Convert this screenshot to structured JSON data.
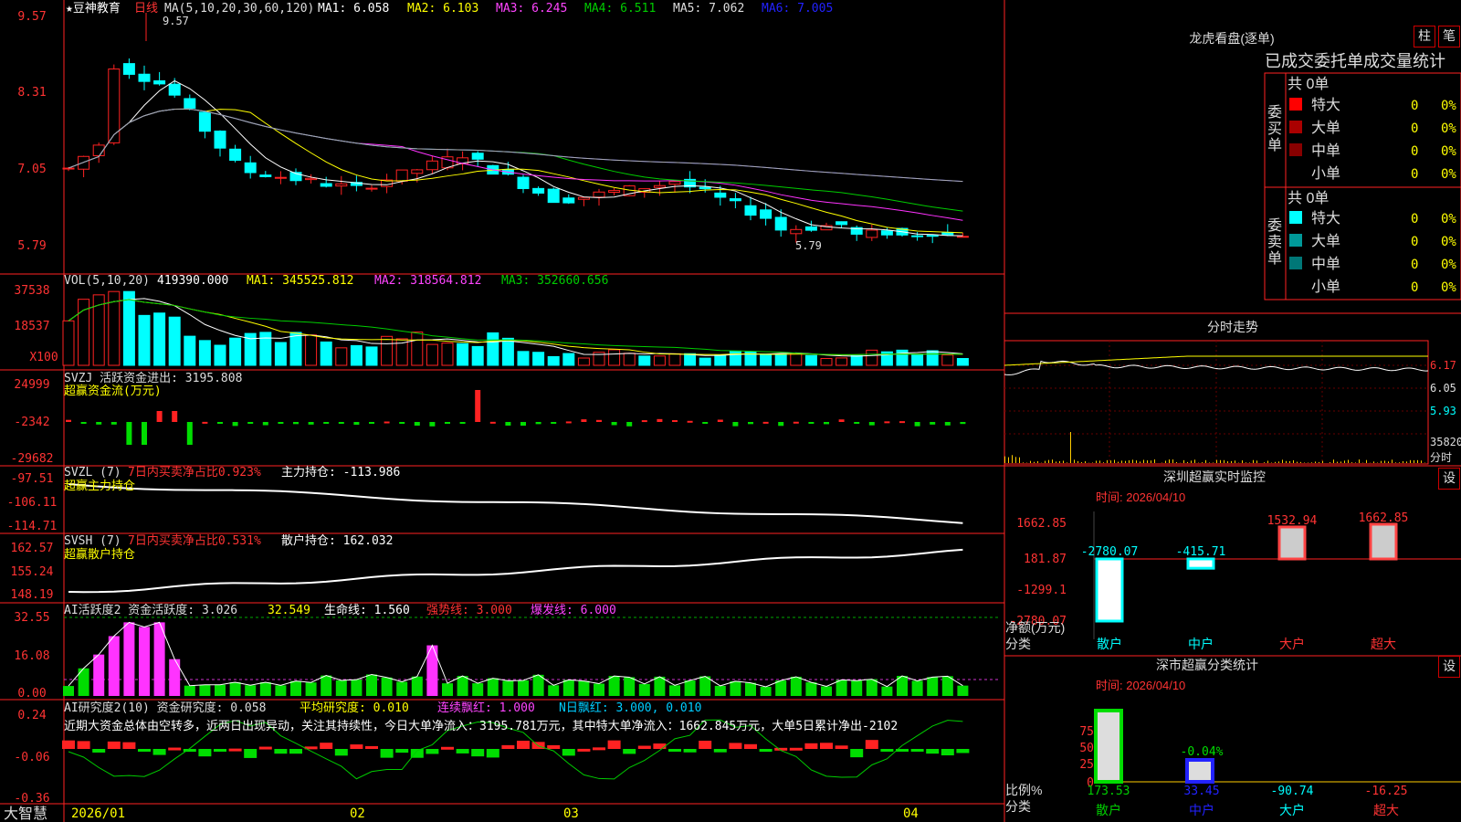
{
  "stock": {
    "name": "★豆神教育",
    "period": "日线"
  },
  "ma": {
    "label": "MA(5,10,20,30,60,120)",
    "ma1": "MA1: 6.058",
    "ma2": "MA2: 6.103",
    "ma3": "MA3: 6.245",
    "ma4": "MA4: 6.511",
    "ma5": "MA5: 7.062",
    "ma6": "MA6: 7.005",
    "high": "9.57",
    "low": "5.79"
  },
  "price_axis": [
    "9.57",
    "8.31",
    "7.05",
    "5.79"
  ],
  "vol": {
    "label": "VOL(5,10,20)",
    "value": "419390.000",
    "ma1": "MA1: 345525.812",
    "ma2": "MA2: 318564.812",
    "ma3": "MA3: 352660.656",
    "axis": [
      "37538",
      "18537"
    ],
    "unit": "X100"
  },
  "svzj": {
    "label": "SVZJ  活跃资金进出: 3195.808",
    "sub": "超赢资金流(万元)",
    "axis": [
      "24999",
      "-2342",
      "-29682"
    ]
  },
  "svzl": {
    "label": "SVZL (7)",
    "pct": "7日内买卖净占比0.923%",
    "main": "主力持仓: -113.986",
    "sub": "超赢主力持仓",
    "axis": [
      "-97.51",
      "-106.11",
      "-114.71"
    ]
  },
  "svsh": {
    "label": "SVSH (7)",
    "pct": "7日内买卖净占比0.531%",
    "retail": "散户持仓: 162.032",
    "sub": "超赢散户持仓",
    "axis": [
      "162.57",
      "155.24",
      "148.19"
    ]
  },
  "ai_act": {
    "label": "AI活跃度2 资金活跃度: 3.026",
    "v2": "32.549",
    "life": "生命线: 1.560",
    "strong": "强势线: 3.000",
    "burst": "爆发线: 6.000",
    "axis": [
      "32.55",
      "16.08",
      "0.00"
    ]
  },
  "ai_res": {
    "label": "AI研究度2(10) 资金研究度: 0.058",
    "avg": "平均研究度: 0.010",
    "red": "连续飘红: 1.000",
    "nred": "N日飘红: 3.000, 0.010",
    "axis": [
      "0.24",
      "-0.06",
      "-0.36"
    ],
    "comment": "近期大资金总体由空转多，近两日出现异动，关注其持续性，今日大单净流入：3195.781万元，其中特大单净流入：1662.845万元，大单5日累计净出-2102"
  },
  "dates": [
    "2026/01",
    "02",
    "03",
    "04"
  ],
  "brand": "大智慧",
  "right": {
    "lhkp": {
      "title": "龙虎看盘(逐单)",
      "btn1": "柱",
      "btn2": "笔",
      "header": "已成交委托单成交量统计",
      "buy": {
        "side": "委买单",
        "total": "共 0单",
        "rows": [
          {
            "name": "特大",
            "count": "0",
            "pct": "0%",
            "color": "#ff0000"
          },
          {
            "name": "大单",
            "count": "0",
            "pct": "0%",
            "color": "#aa0000"
          },
          {
            "name": "中单",
            "count": "0",
            "pct": "0%",
            "color": "#880000"
          },
          {
            "name": "小单",
            "count": "0",
            "pct": "0%",
            "color": "#000000"
          }
        ]
      },
      "sell": {
        "side": "委卖单",
        "total": "共 0单",
        "rows": [
          {
            "name": "特大",
            "count": "0",
            "pct": "0%",
            "color": "#00ffff"
          },
          {
            "name": "大单",
            "count": "0",
            "pct": "0%",
            "color": "#009999"
          },
          {
            "name": "中单",
            "count": "0",
            "pct": "0%",
            "color": "#007777"
          },
          {
            "name": "小单",
            "count": "0",
            "pct": "0%",
            "color": "#000000"
          }
        ]
      }
    },
    "fenshi": {
      "title": "分时走势",
      "axis": [
        "6.17",
        "6.05",
        "5.93"
      ],
      "vol_max": "35820",
      "vol_unit": "分时"
    },
    "monitor": {
      "title": "深圳超赢实时监控",
      "btn": "设",
      "time": "时间: 2026/04/10",
      "axis": [
        "1662.85",
        "181.87",
        "-1299.1",
        "-2780.07"
      ],
      "ylabel": "净额(万元)",
      "xlabel": "分类",
      "cats": [
        "散户",
        "中户",
        "大户",
        "超大"
      ],
      "values": [
        "-2780.07",
        "-415.71",
        "1532.94",
        "1662.85"
      ]
    },
    "stats": {
      "title": "深市超赢分类统计",
      "btn": "设",
      "time": "时间: 2026/04/10",
      "axis": [
        "75",
        "50",
        "25",
        "0"
      ],
      "ylabel": "比例%",
      "xlabel": "分类",
      "cats": [
        "散户",
        "中户",
        "大户",
        "超大"
      ],
      "bar_label": "-0.04%",
      "values": [
        "173.53",
        "33.45",
        "-90.74",
        "-16.25"
      ]
    }
  }
}
